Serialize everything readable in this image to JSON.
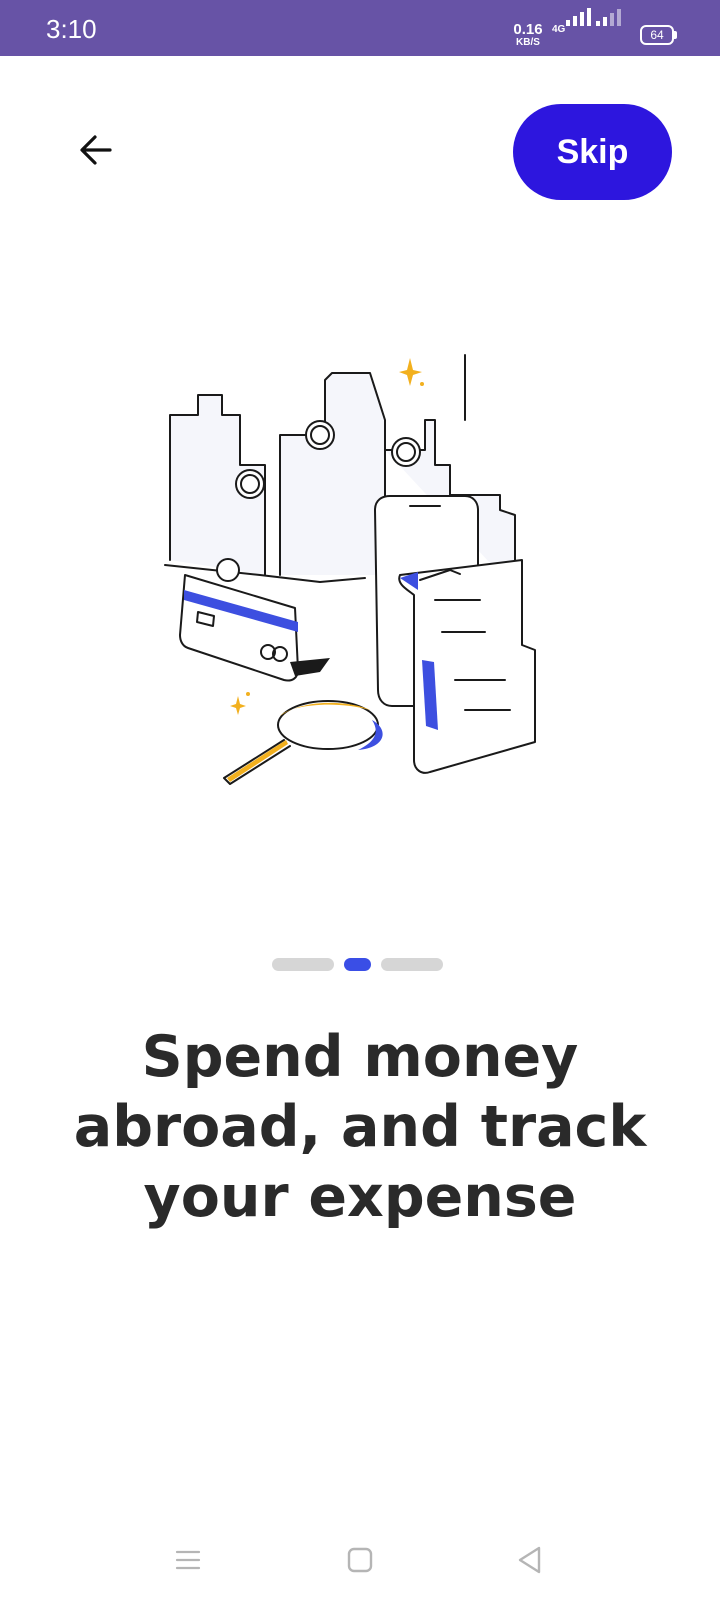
{
  "status_bar": {
    "time": "3:10",
    "net_speed_value": "0.16",
    "net_speed_unit": "KB/S",
    "network_type": "4G",
    "battery": "64",
    "background": "#6753a6"
  },
  "header": {
    "back_icon": "arrow-left-icon",
    "skip_label": "Skip",
    "skip_color": "#2d16de"
  },
  "illustration": {
    "icon": "travel-expense-illustration",
    "accent_blue": "#3d4fe0",
    "accent_yellow": "#f2b01e"
  },
  "pager": {
    "total": 3,
    "active_index": 1,
    "active_color": "#3a4ee6",
    "inactive_color": "#d6d6d6"
  },
  "onboarding": {
    "title_lines": [
      "Spend money",
      "abroad, and track",
      "your expense"
    ]
  },
  "nav_bar": {
    "items": [
      "menu-icon",
      "home-icon",
      "back-triangle-icon"
    ]
  }
}
